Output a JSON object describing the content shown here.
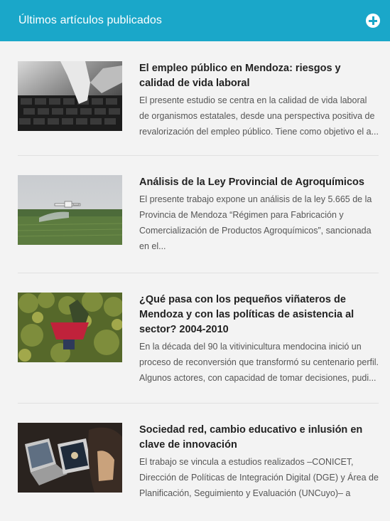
{
  "widget": {
    "title": "Últimos artículos publicados",
    "accent": "#1aa7c9",
    "add_icon": "plus-circle-icon"
  },
  "articles": [
    {
      "title": "El empleo público en Mendoza: riesgos y calidad de vida laboral",
      "excerpt": "El presente estudio se centra en la calidad de vida laboral de organismos estatales, desde una perspectiva positiva de revalorización del empleo público. Tiene como objetivo el a..."
    },
    {
      "title": "Análisis de la Ley Provincial de Agroquímicos",
      "excerpt": "El presente trabajo expone un análisis de la ley 5.665 de la Provincia de Mendoza “Régimen para Fabricación y Comercialización de Productos Agroquímicos”, sancionada en el..."
    },
    {
      "title": "¿Qué pasa con los pequeños viñateros de Mendoza y con las políticas de asistencia al sector? 2004-2010",
      "excerpt": "En la década del 90 la vitivinicultura mendocina inició un proceso de reconversión que transformó su centenario perfil. Algunos actores, con capacidad de tomar decisiones, pudi..."
    },
    {
      "title": "Sociedad red, cambio educativo e inlusión en clave de innovación",
      "excerpt": "El trabajo se vincula a estudios realizados –CONICET, Dirección de Políticas de Integración Digital (DGE) y Área de Planificación, Seguimiento y Evaluación (UNCuyo)– a"
    }
  ]
}
